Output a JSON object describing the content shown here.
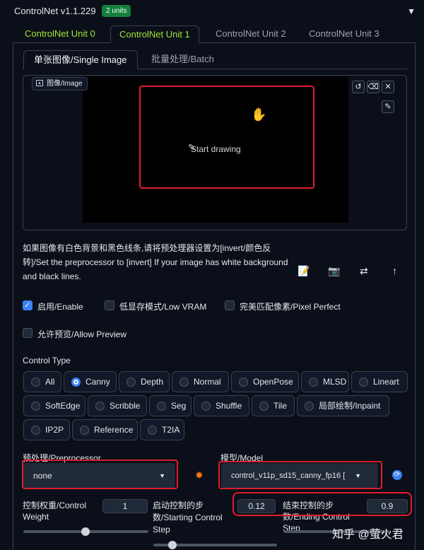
{
  "header": {
    "title": "ControlNet v1.1.229",
    "badge": "2 units",
    "collapse_icon": "triangle-down-icon"
  },
  "unit_tabs": [
    "ControlNet Unit 0",
    "ControlNet Unit 1",
    "ControlNet Unit 2",
    "ControlNet Unit 3"
  ],
  "image_tabs": [
    "单张图像/Single Image",
    "批量处理/Batch"
  ],
  "image": {
    "label": "图像/Image",
    "placeholder": "Start drawing"
  },
  "note": "如果图像有白色背景和黑色线条,请将预处理器设置为[invert/颜色反转]/Set the preprocessor to [invert] If your image has white background and black lines.",
  "checkboxes": {
    "enable": "启用/Enable",
    "low_vram": "低显存模式/Low VRAM",
    "pixel_perfect": "完美匹配像素/Pixel Perfect",
    "allow_preview": "允许预览/Allow Preview"
  },
  "control_type": {
    "label": "Control Type",
    "options": [
      "All",
      "Canny",
      "Depth",
      "Normal",
      "OpenPose",
      "MLSD",
      "Lineart",
      "SoftEdge",
      "Scribble",
      "Seg",
      "Shuffle",
      "Tile",
      "局部绘制/Inpaint",
      "IP2P",
      "Reference",
      "T2IA"
    ],
    "selected": "Canny"
  },
  "preprocessor": {
    "label": "预处理/Preprocessor",
    "value": "none"
  },
  "model": {
    "label": "模型/Model",
    "value": "control_v11p_sd15_canny_fp16 ["
  },
  "weight": {
    "label": "控制权重/Control Weight",
    "value": "1"
  },
  "start_step": {
    "label": "启动控制的步数/Starting Control Step",
    "value": "0.12"
  },
  "end_step": {
    "label": "结束控制的步数/Ending Control Step",
    "value": "0.9"
  },
  "watermark": "知乎 @萤火君",
  "colors": {
    "accent": "#3b82f6",
    "highlight": "#e11d2e",
    "active_tab": "#a3e635",
    "badge": "#15803d"
  }
}
